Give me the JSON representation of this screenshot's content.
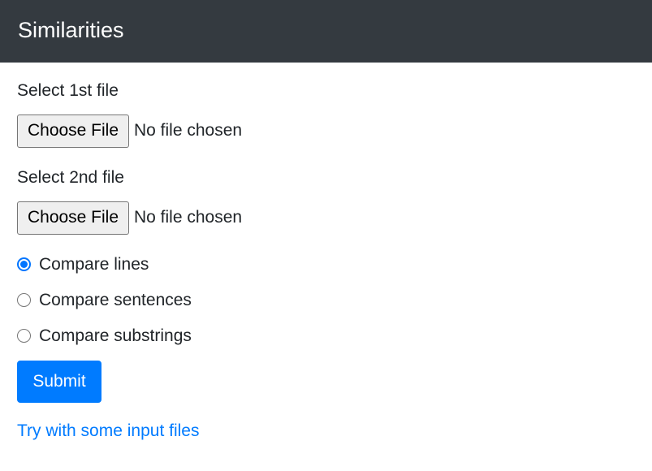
{
  "navbar": {
    "title": "Similarities"
  },
  "form": {
    "file1": {
      "label": "Select 1st file",
      "button_label": "Choose File",
      "status": "No file chosen"
    },
    "file2": {
      "label": "Select 2nd file",
      "button_label": "Choose File",
      "status": "No file chosen"
    },
    "options": [
      {
        "label": "Compare lines",
        "checked": true
      },
      {
        "label": "Compare sentences",
        "checked": false
      },
      {
        "label": "Compare substrings",
        "checked": false
      }
    ],
    "submit_label": "Submit",
    "sample_link": "Try with some input files"
  },
  "colors": {
    "navbar_bg": "#343a40",
    "primary": "#007bff",
    "radio_accent": "#0075ff"
  }
}
